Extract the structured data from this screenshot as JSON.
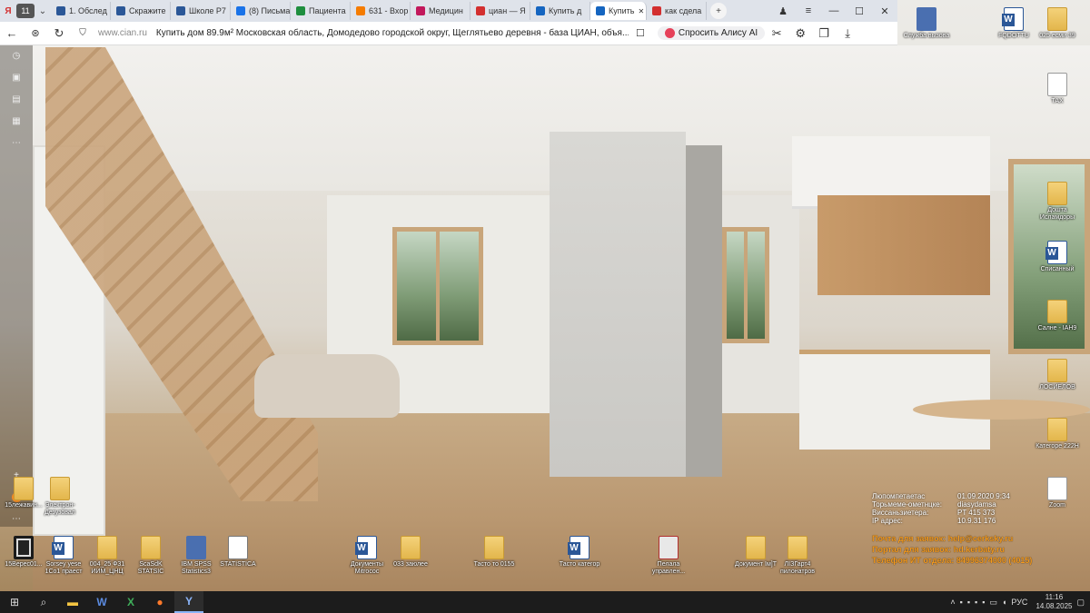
{
  "browser": {
    "tabs": [
      {
        "label": "1. Обслед",
        "color": "#2b5797"
      },
      {
        "label": "Скражите",
        "color": "#2b5797"
      },
      {
        "label": "Школе Р7",
        "color": "#2b5797"
      },
      {
        "label": "(8) Письма",
        "color": "#1a73e8"
      },
      {
        "label": "Пациента",
        "color": "#1e8e3e"
      },
      {
        "label": "631 - Вхор",
        "color": "#f57c00"
      },
      {
        "label": "Медицин",
        "color": "#c2185b"
      },
      {
        "label": "циан — Я",
        "color": "#d32f2f"
      },
      {
        "label": "Купить д",
        "color": "#1565c0"
      },
      {
        "label": "Купить",
        "color": "#1565c0",
        "active": true
      },
      {
        "label": "как сдела",
        "color": "#d32f2f"
      }
    ],
    "tab_count": "11",
    "domain": "www.cian.ru",
    "page_title": "Купить дом 89.9м² Московская область, Домодедово городской округ, Щеглятьево деревня - база ЦИАН, объя...",
    "alice_label": "Спросить Алису AI"
  },
  "desktop_icons": [
    {
      "label": "Служба вызова",
      "glyph": "app-icon"
    },
    {
      "label": "FQDOTTU",
      "glyph": "word-icon"
    },
    {
      "label": "025 есми 39",
      "glyph": "folder-icon"
    },
    {
      "label": "ТАХ",
      "glyph": "doc-icon"
    },
    {
      "label": "Дошта Исламдоры",
      "glyph": "folder-icon"
    },
    {
      "label": "Списанный",
      "glyph": "word-icon"
    },
    {
      "label": "Салне - ІАН9",
      "glyph": "folder-icon"
    },
    {
      "label": "ЛОСИЕЛОВ",
      "glyph": "folder-icon"
    },
    {
      "label": "Категоре 222Н",
      "glyph": "folder-icon"
    },
    {
      "label": "Zoom",
      "glyph": "doc-icon"
    },
    {
      "label": "15лежавин...",
      "glyph": "folder-icon"
    },
    {
      "label": "Электрон- Дезузовал",
      "glyph": "folder-icon"
    },
    {
      "label": "15Верес01...",
      "glyph": "dark-icon"
    },
    {
      "label": "Sorsey yese 1Со1 праест",
      "glyph": "word-icon"
    },
    {
      "label": "004_25 Ф31 ИИМ_ЦНЦ",
      "glyph": "folder-icon"
    },
    {
      "label": "ScaSdK STATSIC",
      "glyph": "folder-icon"
    },
    {
      "label": "IBM SPSS Statistics3",
      "glyph": "app-icon"
    },
    {
      "label": "STATISTICA",
      "glyph": "stat-icon"
    },
    {
      "label": "Документы Мitrococ",
      "glyph": "word-icon"
    },
    {
      "label": "033 заюлее",
      "glyph": "folder-icon"
    },
    {
      "label": "Тасто то 0155",
      "glyph": "folder-icon"
    },
    {
      "label": "Тасто категор",
      "glyph": "word-icon"
    },
    {
      "label": "Пелала управлен...",
      "glyph": "red-icon"
    },
    {
      "label": "Документ Ім]Т",
      "glyph": "folder-icon"
    },
    {
      "label": "ЛІЗГарт4 пилонатров",
      "glyph": "folder-icon"
    }
  ],
  "bginfo": [
    {
      "key": "Люпомпетаетас",
      "value": "01.09.2020 9:34"
    },
    {
      "key": "Торьмеме-ометнцке:",
      "value": "diasydamsa"
    },
    {
      "key": "Виссаньзиетера:",
      "value": "PT 415 373"
    },
    {
      "key": "IP адрес:",
      "value": "10.9.31 176"
    }
  ],
  "helpdesk": [
    {
      "key": "Почта для заявок:",
      "value": "help@cerksky.ru"
    },
    {
      "key": "Портал для заявок:",
      "value": "hd.kerbaty.ru"
    },
    {
      "key": "Телефон ИТ отдела:",
      "value": "84996374000 (4015)"
    }
  ],
  "taskbar": {
    "lang": "РУС",
    "time": "11:16",
    "date": "14.08.2025"
  }
}
